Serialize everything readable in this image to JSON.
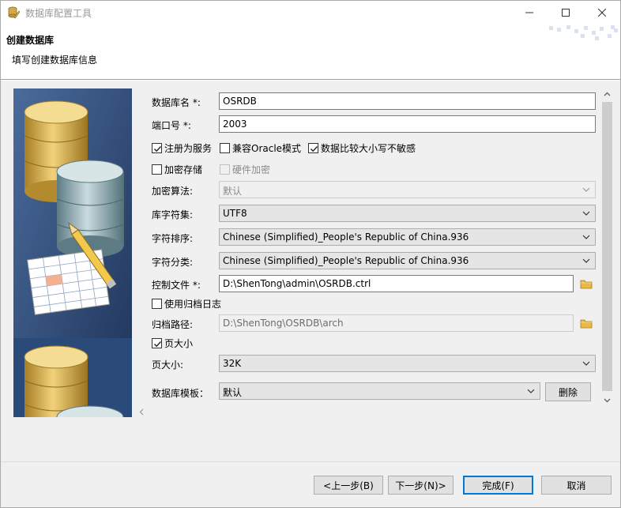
{
  "window": {
    "title": "数据库配置工具"
  },
  "header": {
    "title": "创建数据库",
    "subtitle": "填写创建数据库信息"
  },
  "form": {
    "db_name": {
      "label": "数据库名 *:",
      "value": "OSRDB"
    },
    "port": {
      "label": "端口号 *:",
      "value": "2003"
    },
    "register_service": {
      "label": "注册为服务",
      "checked": true
    },
    "oracle_compat": {
      "label": "兼容Oracle模式",
      "checked": false
    },
    "case_insensitive": {
      "label": "数据比较大小写不敏感",
      "checked": true
    },
    "encrypt_storage": {
      "label": "加密存储",
      "checked": false
    },
    "hardware_encrypt": {
      "label": "硬件加密",
      "checked": false
    },
    "encrypt_algo": {
      "label": "加密算法:",
      "value": "默认"
    },
    "charset": {
      "label": "库字符集:",
      "value": "UTF8"
    },
    "collation": {
      "label": "字符排序:",
      "value": "Chinese (Simplified)_People's Republic of China.936"
    },
    "char_class": {
      "label": "字符分类:",
      "value": "Chinese (Simplified)_People's Republic of China.936"
    },
    "control_file": {
      "label": "控制文件 *:",
      "value": "D:\\ShenTong\\admin\\OSRDB.ctrl"
    },
    "archive_log": {
      "label": "使用归档日志",
      "checked": false
    },
    "archive_path": {
      "label": "归档路径:",
      "value": "D:\\ShenTong\\OSRDB\\arch"
    },
    "page_size_check": {
      "label": "页大小",
      "checked": true
    },
    "page_size": {
      "label": "页大小:",
      "value": "32K"
    },
    "template": {
      "label": "数据库模板：",
      "value": "默认",
      "delete_label": "删除"
    }
  },
  "footer": {
    "prev_label": "<上一步(B)",
    "next_label": "下一步(N)>",
    "finish_label": "完成(F)",
    "cancel_label": "取消"
  },
  "colors": {
    "accent": "#0078d7",
    "side_bg": "#2d4b78",
    "folder": "#e8b84a"
  }
}
